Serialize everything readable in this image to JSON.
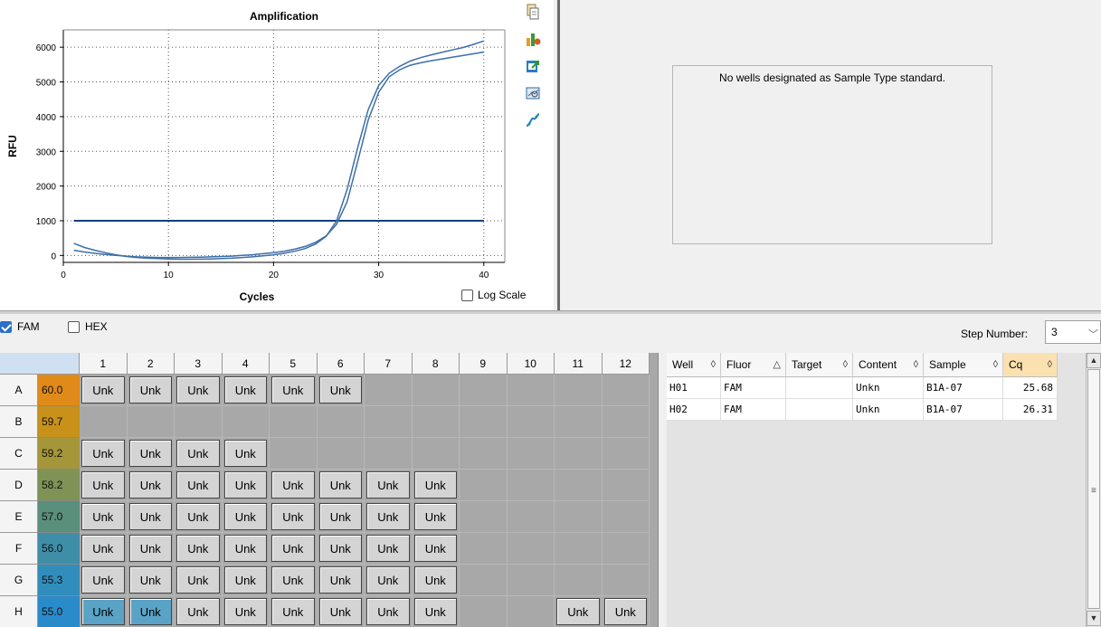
{
  "chart": {
    "log_scale_label": "Log Scale",
    "log_scale_checked": false
  },
  "chart_data": {
    "type": "line",
    "title": "Amplification",
    "xlabel": "Cycles",
    "ylabel": "RFU",
    "xlim": [
      0,
      42
    ],
    "ylim": [
      -200,
      6500
    ],
    "xticks": [
      0,
      10,
      20,
      30,
      40
    ],
    "yticks": [
      0,
      1000,
      2000,
      3000,
      4000,
      5000,
      6000
    ],
    "grid": true,
    "threshold": 1000,
    "series": [
      {
        "x": [
          1,
          2,
          3,
          4,
          5,
          6,
          7,
          8,
          9,
          10,
          11,
          12,
          13,
          14,
          15,
          16,
          17,
          18,
          19,
          20,
          21,
          22,
          23,
          24,
          25,
          26,
          27,
          28,
          29,
          30,
          31,
          32,
          33,
          34,
          35,
          36,
          37,
          38,
          39,
          40
        ],
        "y": [
          350,
          230,
          150,
          80,
          20,
          -30,
          -60,
          -80,
          -90,
          -100,
          -110,
          -110,
          -105,
          -100,
          -90,
          -80,
          -60,
          -40,
          -10,
          20,
          60,
          120,
          200,
          330,
          550,
          1000,
          1900,
          3100,
          4200,
          4900,
          5250,
          5450,
          5600,
          5700,
          5780,
          5850,
          5920,
          5990,
          6080,
          6180
        ]
      },
      {
        "x": [
          1,
          2,
          3,
          4,
          5,
          6,
          7,
          8,
          9,
          10,
          11,
          12,
          13,
          14,
          15,
          16,
          17,
          18,
          19,
          20,
          21,
          22,
          23,
          24,
          25,
          26,
          27,
          28,
          29,
          30,
          31,
          32,
          33,
          34,
          35,
          36,
          37,
          38,
          39,
          40
        ],
        "y": [
          150,
          100,
          60,
          30,
          0,
          -20,
          -40,
          -50,
          -60,
          -60,
          -60,
          -55,
          -50,
          -40,
          -30,
          -20,
          0,
          20,
          50,
          80,
          120,
          180,
          260,
          380,
          560,
          900,
          1550,
          2700,
          3900,
          4700,
          5150,
          5350,
          5480,
          5550,
          5610,
          5660,
          5710,
          5760,
          5810,
          5860
        ]
      }
    ],
    "colors": {
      "curve": "#3d6fa8",
      "threshold": "#0e3f7c",
      "axis": "#000000"
    }
  },
  "icons": [
    "copy-icon",
    "chart-settings-icon",
    "export-icon",
    "zoom-icon",
    "curve-icon"
  ],
  "std_curve": {
    "message": "No wells designated as Sample Type standard."
  },
  "fluors": [
    {
      "label": "FAM",
      "checked": true
    },
    {
      "label": "HEX",
      "checked": false
    }
  ],
  "step": {
    "label": "Step Number:",
    "value": "3"
  },
  "plate": {
    "columns": [
      "1",
      "2",
      "3",
      "4",
      "5",
      "6",
      "7",
      "8",
      "9",
      "10",
      "11",
      "12"
    ],
    "rows": [
      {
        "label": "A",
        "temp": "60.0",
        "temp_color": "#e08a1a",
        "wells": [
          1,
          2,
          3,
          4,
          5,
          6
        ]
      },
      {
        "label": "B",
        "temp": "59.7",
        "temp_color": "#c8911a",
        "wells": []
      },
      {
        "label": "C",
        "temp": "59.2",
        "temp_color": "#a6963a",
        "wells": [
          1,
          2,
          3,
          4
        ]
      },
      {
        "label": "D",
        "temp": "58.2",
        "temp_color": "#7f9356",
        "wells": [
          1,
          2,
          3,
          4,
          5,
          6,
          7,
          8
        ]
      },
      {
        "label": "E",
        "temp": "57.0",
        "temp_color": "#5a8f7c",
        "wells": [
          1,
          2,
          3,
          4,
          5,
          6,
          7,
          8
        ]
      },
      {
        "label": "F",
        "temp": "56.0",
        "temp_color": "#3f8ea8",
        "wells": [
          1,
          2,
          3,
          4,
          5,
          6,
          7,
          8
        ]
      },
      {
        "label": "G",
        "temp": "55.3",
        "temp_color": "#318dbc",
        "wells": [
          1,
          2,
          3,
          4,
          5,
          6,
          7,
          8
        ]
      },
      {
        "label": "H",
        "temp": "55.0",
        "temp_color": "#2a8bcb",
        "wells": [
          1,
          2,
          3,
          4,
          5,
          6,
          7,
          8,
          11,
          12
        ],
        "selected": [
          1,
          2
        ]
      }
    ],
    "well_label": "Unk"
  },
  "table": {
    "headers": [
      {
        "label": "Well",
        "arrow": "◊"
      },
      {
        "label": "Fluor",
        "arrow": "△"
      },
      {
        "label": "Target",
        "arrow": "◊"
      },
      {
        "label": "Content",
        "arrow": "◊"
      },
      {
        "label": "Sample",
        "arrow": "◊"
      },
      {
        "label": "Cq",
        "arrow": "◊"
      }
    ],
    "rows": [
      [
        "H01",
        "FAM",
        "",
        "Unkn",
        "B1A-07",
        "25.68"
      ],
      [
        "H02",
        "FAM",
        "",
        "Unkn",
        "B1A-07",
        "26.31"
      ]
    ]
  }
}
